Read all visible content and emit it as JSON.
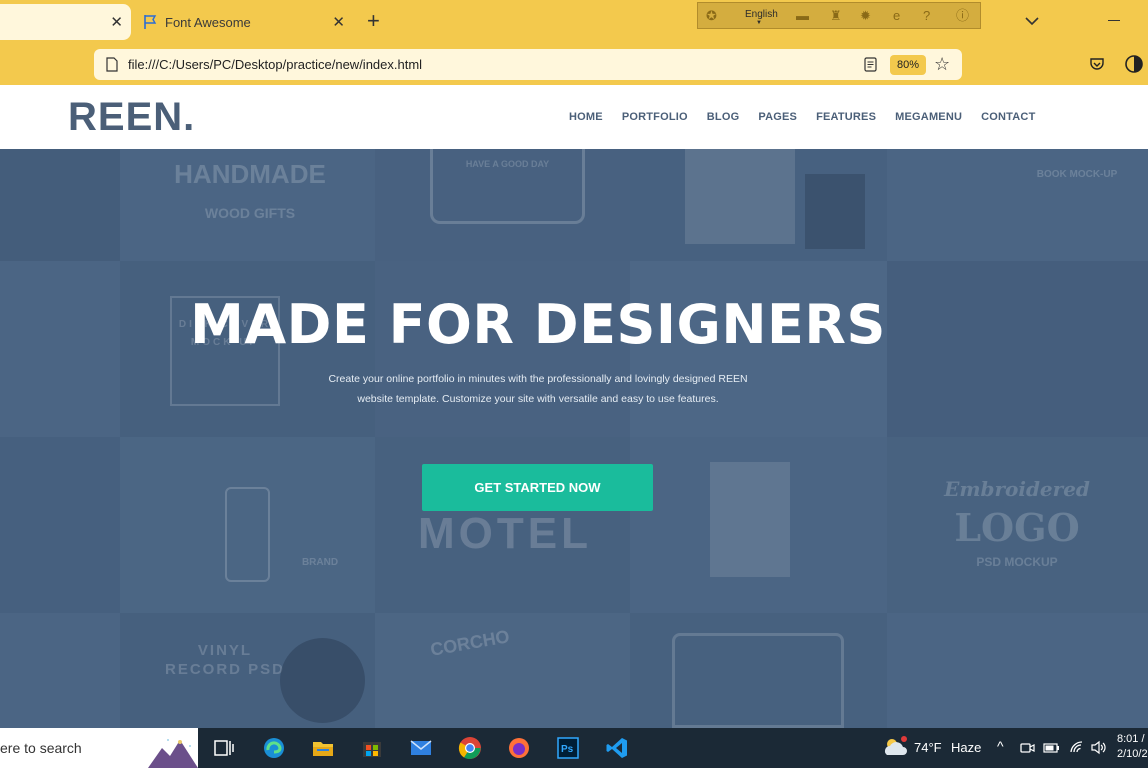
{
  "browser": {
    "tabs": [
      {
        "title": "",
        "active": true
      },
      {
        "title": "Font Awesome",
        "active": false
      }
    ],
    "new_tab_label": "+",
    "close_glyph": "✕",
    "address": "file:///C:/Users/PC/Desktop/practice/new/index.html",
    "zoom": "80%",
    "language": "English"
  },
  "site": {
    "logo": "REEN.",
    "nav": [
      "HOME",
      "PORTFOLIO",
      "BLOG",
      "PAGES",
      "FEATURES",
      "MEGAMENU",
      "CONTACT"
    ],
    "hero": {
      "title": "MADE FOR DESIGNERS",
      "subtitle": "Create your online portfolio in minutes with the professionally and lovingly designed REEN website template. Customize your site with versatile and easy to use features.",
      "cta": "GET STARTED NOW"
    },
    "mockup_labels": {
      "handmade": "HANDMADE",
      "wood": "WOOD GIFTS",
      "goodday": "HAVE A GOOD DAY",
      "disk": "DISK COVER MOCK UP",
      "motel": "MOTEL",
      "logo": "LOGO",
      "embroidered": "Embroidered",
      "psdmockup": "PSD MOCKUP",
      "vinyl": "VINYL RECORD PSD",
      "corcho": "CORCHO",
      "brand": "BRAND",
      "bookmockup": "BOOK MOCK-UP"
    },
    "colors": {
      "logo": "#4b5f78",
      "cta": "#1abc9c",
      "hero_overlay": "#4b6585"
    }
  },
  "taskbar": {
    "search_placeholder": "ere to search",
    "weather_temp": "74°F",
    "weather_desc": "Haze",
    "time": "8:01 /",
    "date": "2/10/2",
    "apps": [
      "task-view",
      "edge",
      "file-explorer",
      "store",
      "mail",
      "chrome",
      "firefox",
      "photoshop",
      "vscode"
    ]
  }
}
